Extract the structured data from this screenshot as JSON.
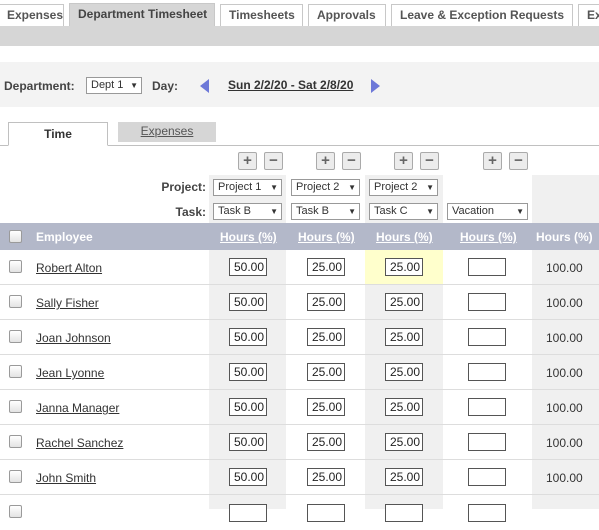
{
  "top_tabs": [
    {
      "label": "Expenses",
      "active": false
    },
    {
      "label": "Department Timesheet",
      "active": true
    },
    {
      "label": "Timesheets",
      "active": false
    },
    {
      "label": "Approvals",
      "active": false
    },
    {
      "label": "Leave & Exception Requests",
      "active": false
    },
    {
      "label": "Ex",
      "active": false
    }
  ],
  "filter": {
    "department_label": "Department:",
    "department_value": "Dept 1",
    "day_label": "Day:",
    "date_range": "Sun 2/2/20 - Sat 2/8/20"
  },
  "sub_tabs": {
    "time": "Time",
    "expenses": "Expenses"
  },
  "row_labels": {
    "project": "Project:",
    "task": "Task:"
  },
  "columns": [
    {
      "project": "Project 1",
      "task": "Task B"
    },
    {
      "project": "Project 2",
      "task": "Task B"
    },
    {
      "project": "Project 2",
      "task": "Task C"
    },
    {
      "project": "",
      "task": "Vacation"
    }
  ],
  "header": {
    "employee": "Employee",
    "hours_pct": "Hours (%)",
    "total_hours_pct": "Hours (%)"
  },
  "rows": [
    {
      "name": "Robert Alton",
      "h": [
        "50.00",
        "25.00",
        "25.00",
        ""
      ],
      "total": "100.00"
    },
    {
      "name": "Sally Fisher",
      "h": [
        "50.00",
        "25.00",
        "25.00",
        ""
      ],
      "total": "100.00"
    },
    {
      "name": "Joan Johnson",
      "h": [
        "50.00",
        "25.00",
        "25.00",
        ""
      ],
      "total": "100.00"
    },
    {
      "name": "Jean Lyonne",
      "h": [
        "50.00",
        "25.00",
        "25.00",
        ""
      ],
      "total": "100.00"
    },
    {
      "name": "Janna Manager",
      "h": [
        "50.00",
        "25.00",
        "25.00",
        ""
      ],
      "total": "100.00"
    },
    {
      "name": "Rachel Sanchez",
      "h": [
        "50.00",
        "25.00",
        "25.00",
        ""
      ],
      "total": "100.00"
    },
    {
      "name": "John Smith",
      "h": [
        "50.00",
        "25.00",
        "25.00",
        ""
      ],
      "total": "100.00"
    }
  ],
  "colors": {
    "header_bg": "#b3b8c9",
    "nav_arrow": "#6d78d8",
    "highlight": "#ffffcc",
    "tab_bar": "#d6d6d6"
  }
}
